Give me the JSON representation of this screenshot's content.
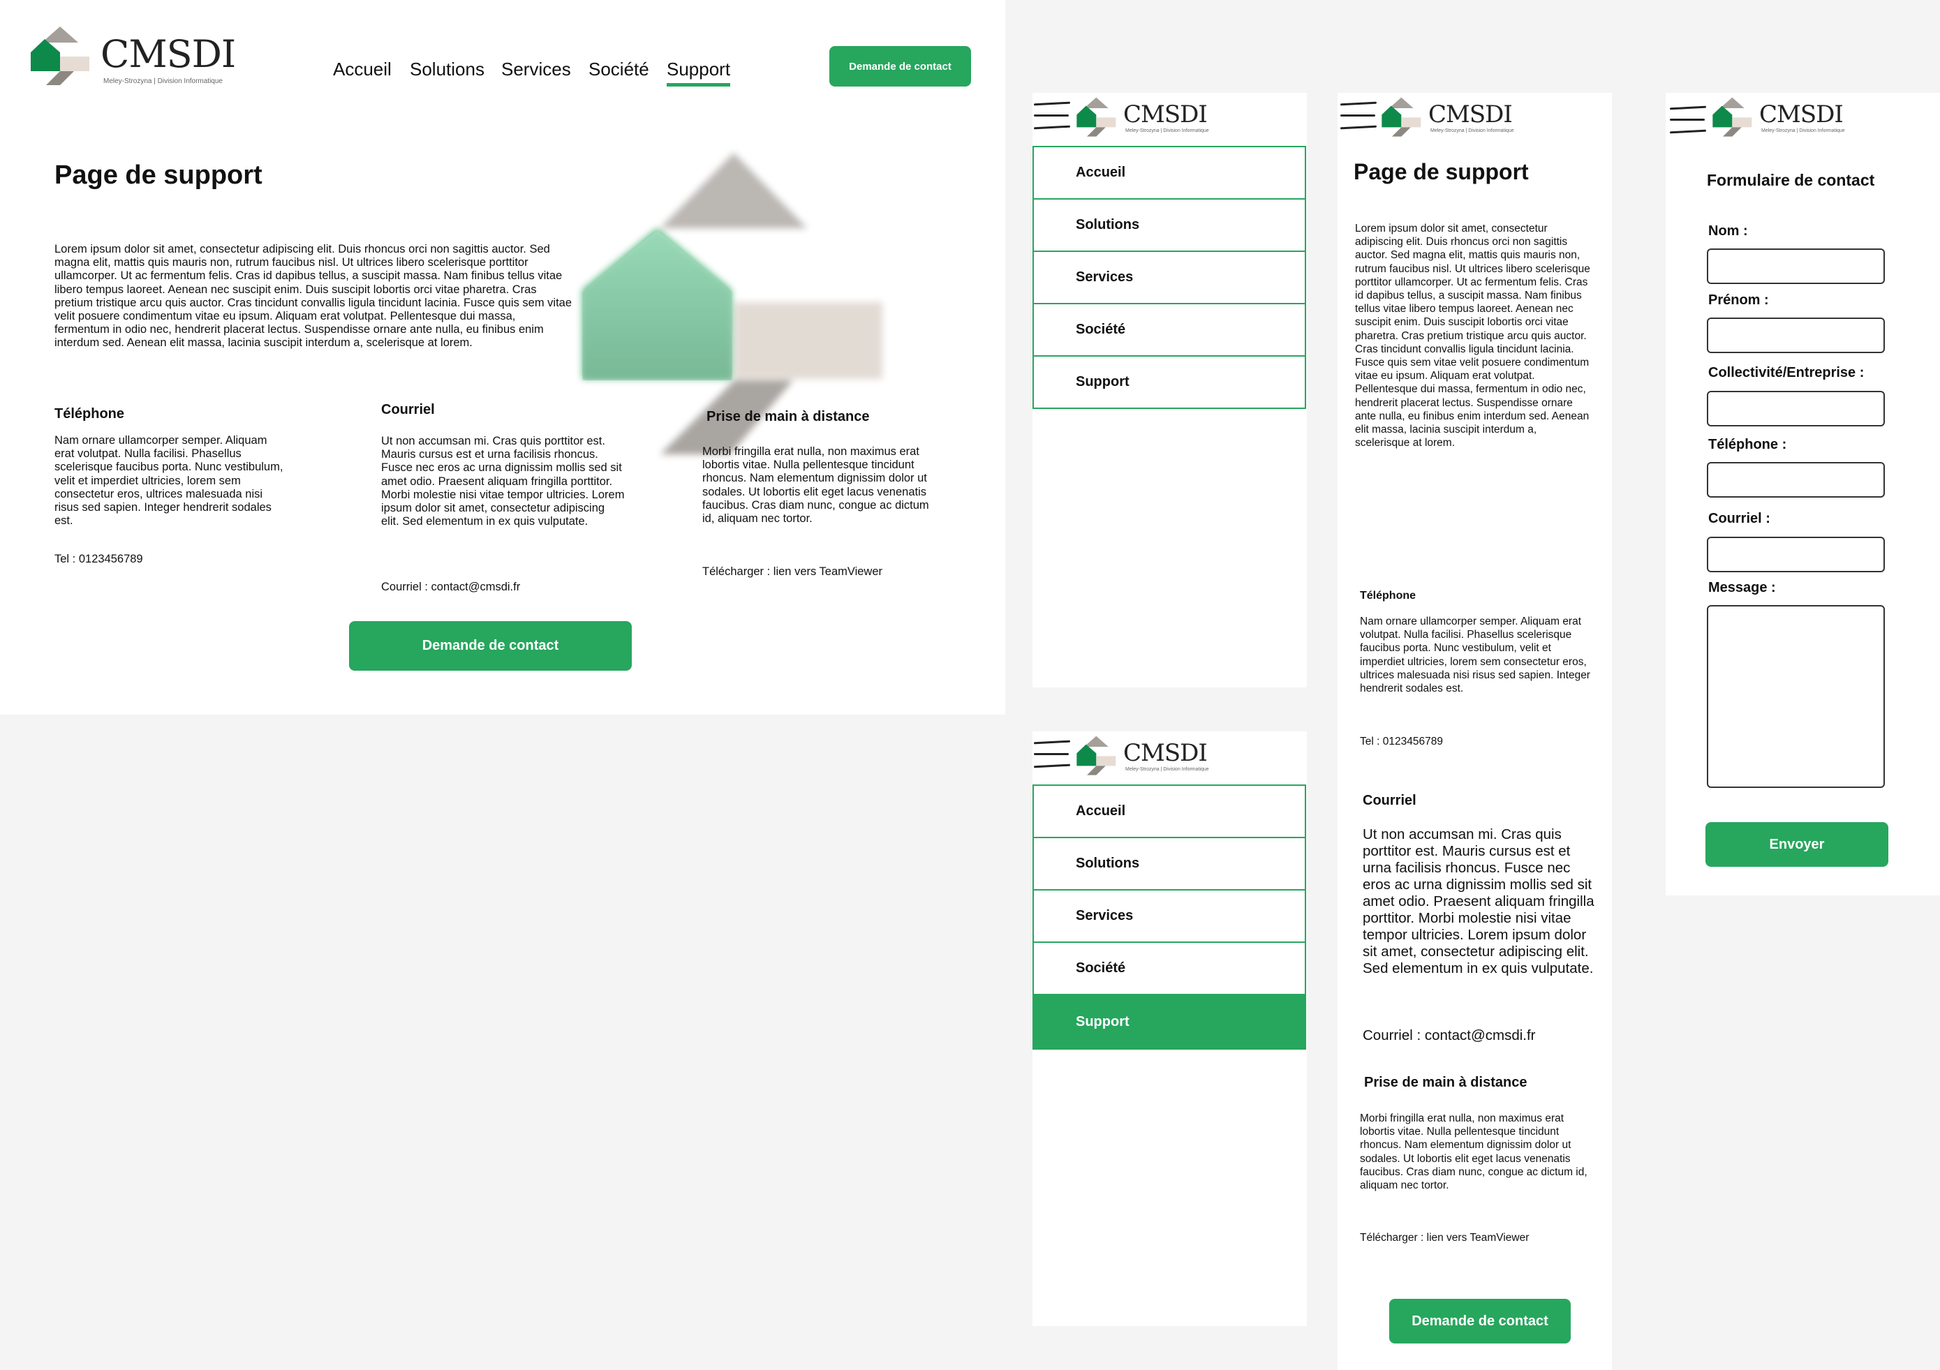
{
  "brand": {
    "name": "CMSDI",
    "tagline": "Meley-Strozyna | Division Informatique"
  },
  "colors": {
    "accent": "#27a65e",
    "canvas": "#f4f4f4",
    "beige": "#e6dcd3",
    "taupe": "#a59f9a"
  },
  "nav": {
    "items": [
      "Accueil",
      "Solutions",
      "Services",
      "Société",
      "Support"
    ],
    "active": "Support"
  },
  "cta": {
    "label": "Demande de contact"
  },
  "support": {
    "title": "Page de support",
    "intro": "Lorem ipsum dolor sit amet, consectetur adipiscing elit. Duis rhoncus orci non sagittis auctor. Sed magna elit, mattis quis mauris non, rutrum faucibus nisl. Ut ultrices libero scelerisque porttitor ullamcorper. Ut ac fermentum felis. Cras id dapibus tellus, a suscipit massa. Nam finibus tellus vitae libero tempus laoreet. Aenean nec suscipit enim. Duis suscipit lobortis orci vitae pharetra. Cras pretium tristique arcu quis auctor. Cras tincidunt convallis ligula tincidunt lacinia. Fusce quis sem vitae velit posuere condimentum vitae eu ipsum. Aliquam erat volutpat. Pellentesque dui massa, fermentum in odio nec, hendrerit placerat lectus. Suspendisse ornare ante nulla, eu finibus enim interdum sed. Aenean elit massa, lacinia suscipit interdum a, scelerisque at lorem.",
    "phone": {
      "title": "Téléphone",
      "body": "Nam ornare ullamcorper semper. Aliquam erat volutpat. Nulla facilisi. Phasellus scelerisque faucibus porta. Nunc vestibulum, velit et imperdiet ultricies, lorem sem consectetur eros, ultrices malesuada nisi risus sed sapien. Integer hendrerit sodales est.",
      "line": "Tel : 0123456789"
    },
    "email": {
      "title": "Courriel",
      "body": "Ut non accumsan mi. Cras quis porttitor est. Mauris cursus est et urna facilisis rhoncus. Fusce nec eros ac urna dignissim mollis sed sit amet odio. Praesent aliquam fringilla porttitor. Morbi molestie nisi vitae tempor ultricies. Lorem ipsum dolor sit amet, consectetur adipiscing elit. Sed elementum in ex quis vulputate.",
      "line": "Courriel : contact@cmsdi.fr"
    },
    "remote": {
      "title": "Prise de main à distance",
      "body": "Morbi fringilla erat nulla, non maximus erat lobortis vitae. Nulla pellentesque tincidunt rhoncus. Nam elementum dignissim dolor ut sodales. Ut lobortis elit eget lacus venenatis faucibus. Cras diam nunc, congue ac dictum id, aliquam nec tortor.",
      "line": "Télécharger : lien vers TeamViewer"
    }
  },
  "form": {
    "title": "Formulaire de contact",
    "labels": {
      "nom": "Nom :",
      "prenom": "Prénom :",
      "entreprise": "Collectivité/Entreprise :",
      "telephone": "Téléphone :",
      "courriel": "Courriel :",
      "message": "Message :"
    },
    "submit": "Envoyer"
  }
}
